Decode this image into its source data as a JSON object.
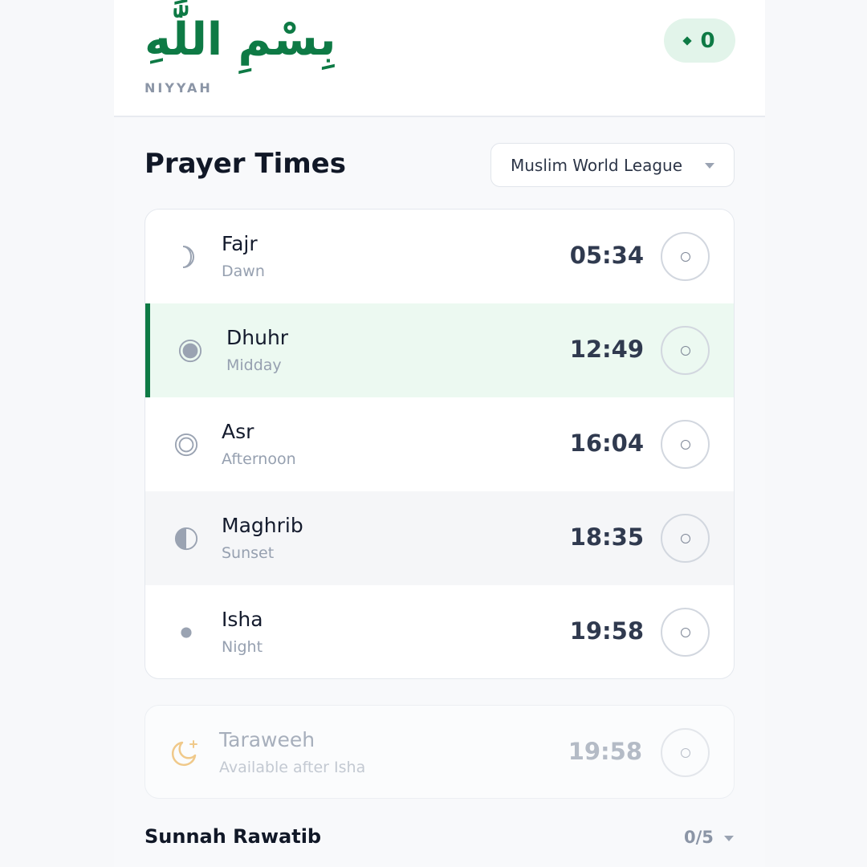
{
  "header": {
    "logo_arabic": "بِسْمِ اللَّٰهِ",
    "logo_text": "NIYYAH",
    "score": "0"
  },
  "main": {
    "title": "Prayer Times",
    "method": "Muslim World League",
    "prayers": [
      {
        "name": "Fajr",
        "subtitle": "Dawn",
        "time": "05:34",
        "icon": "crescent-moon-icon",
        "state": "normal"
      },
      {
        "name": "Dhuhr",
        "subtitle": "Midday",
        "time": "12:49",
        "icon": "sun-full-icon",
        "state": "active"
      },
      {
        "name": "Asr",
        "subtitle": "Afternoon",
        "time": "16:04",
        "icon": "sun-ring-icon",
        "state": "normal"
      },
      {
        "name": "Maghrib",
        "subtitle": "Sunset",
        "time": "18:35",
        "icon": "half-moon-icon",
        "state": "muted"
      },
      {
        "name": "Isha",
        "subtitle": "Night",
        "time": "19:58",
        "icon": "dot-icon",
        "state": "normal"
      }
    ],
    "taraweeh": {
      "name": "Taraweeh",
      "subtitle": "Available after Isha",
      "time": "19:58",
      "icon": "moon-star-icon"
    },
    "sunnah": {
      "title": "Sunnah Rawatib",
      "count": "0/5"
    }
  },
  "colors": {
    "accent": "#0e7a45",
    "accent_bg": "#ecf9f1",
    "text": "#141b2d",
    "muted": "#96a0b0"
  }
}
